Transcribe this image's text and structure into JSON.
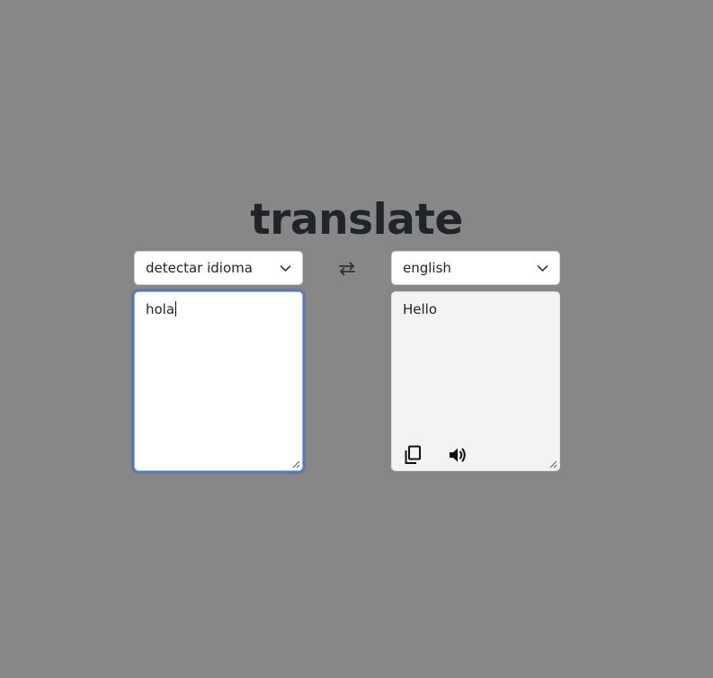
{
  "title": "translate",
  "source": {
    "language": "detectar idioma",
    "text": "hola"
  },
  "target": {
    "language": "english",
    "text": "Hello"
  },
  "icons": {
    "swap": "swap-arrows-icon",
    "chevron": "chevron-down-icon",
    "copy": "copy-icon",
    "speaker": "speaker-icon"
  }
}
